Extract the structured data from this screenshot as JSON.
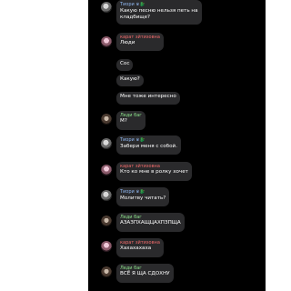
{
  "users": {
    "tiori": "Тиори",
    "karat": "карат зйтизовна",
    "ledi": "Леди баг"
  },
  "badges": {
    "crown": "♛",
    "dragon": "🐉"
  },
  "messages": [
    {
      "author": "tiori",
      "text1": "Какую песню нельзя петь на",
      "text2": "кладбище?"
    },
    {
      "author": "karat",
      "text1": "Люди"
    },
    {
      "author": "",
      "text1": "Сос"
    },
    {
      "author": "",
      "text1": "Какую?"
    },
    {
      "author": "",
      "text1": "Мне тоже интересно"
    },
    {
      "author": "ledi",
      "text1": "М?"
    },
    {
      "author": "tiori",
      "text1": "Забери меня с собой."
    },
    {
      "author": "karat",
      "text1": "Кто ко мне в ролку хочет"
    },
    {
      "author": "tiori",
      "text1": "Молитву читать?"
    },
    {
      "author": "ledi",
      "text1": "АЗАЗПХАЩЦАХПЗПЩА"
    },
    {
      "author": "karat",
      "text1": "Хахахахаха"
    },
    {
      "author": "ledi",
      "text1": "ВСЁ Я ЩА СДОХНУ"
    }
  ],
  "colors": {
    "chat_background": "#000000",
    "bubble": "#2a2a2c",
    "name_tiori": "#8fb6ee",
    "name_karat": "#f26b6b",
    "name_ledi": "#8be08a"
  }
}
